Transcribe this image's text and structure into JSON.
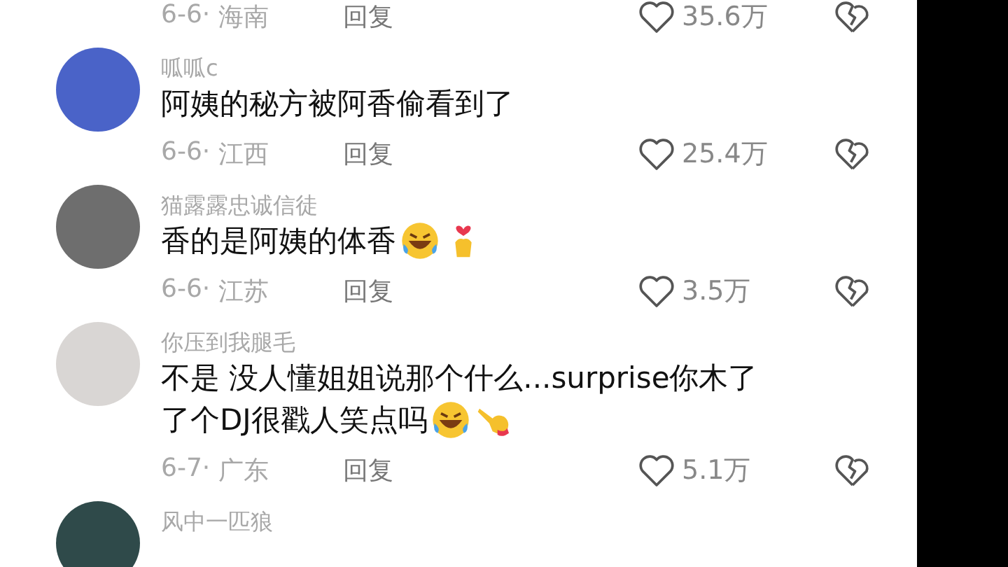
{
  "comments": [
    {
      "date": "6-6·",
      "location": "海南",
      "reply": "回复",
      "likes": "35.6万"
    },
    {
      "username": "呱呱c",
      "lines": [
        "阿姨的秘方被阿香偷看到了"
      ],
      "date": "6-6·",
      "location": "江西",
      "reply": "回复",
      "likes": "25.4万"
    },
    {
      "username": "猫露露忠诚信徒",
      "lines": [
        "香的是阿姨的体香"
      ],
      "emojis": [
        {
          "kind": "laughing"
        },
        {
          "kind": "heart-hands"
        }
      ],
      "date": "6-6·",
      "location": "江苏",
      "reply": "回复",
      "likes": "3.5万"
    },
    {
      "username": "你压到我腿毛",
      "lines": [
        "不是 没人懂姐姐说那个什么...surprise你木了",
        "了个DJ很戳人笑点吗"
      ],
      "emojis": [
        {
          "kind": "laughing"
        },
        {
          "kind": "pointing-hand"
        }
      ],
      "date": "6-7·",
      "location": "广东",
      "reply": "回复",
      "likes": "5.1万"
    },
    {
      "username": "风中一匹狼"
    }
  ]
}
